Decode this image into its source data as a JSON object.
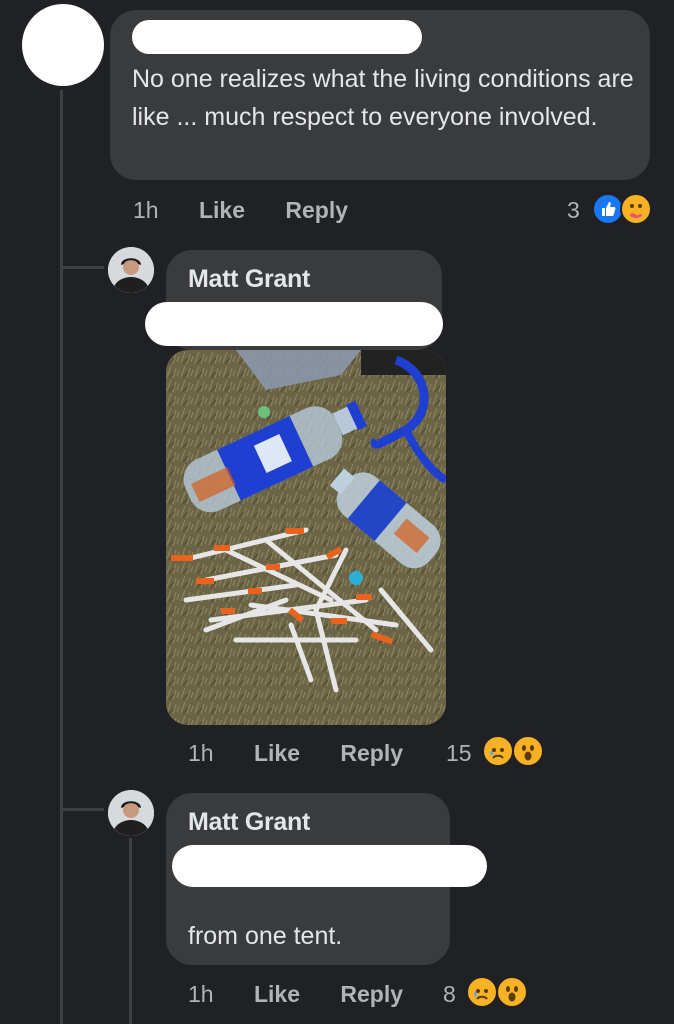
{
  "comments": [
    {
      "author": "",
      "text": "No one realizes what the living conditions are like ... much respect to everyone involved.",
      "time": "1h",
      "like_label": "Like",
      "reply_label": "Reply",
      "reaction_count": "3",
      "reactions": [
        "like-icon",
        "care-icon"
      ]
    },
    {
      "author": "Matt Grant",
      "text": "",
      "time": "1h",
      "like_label": "Like",
      "reply_label": "Reply",
      "reaction_count": "15",
      "reactions": [
        "sad-icon",
        "wow-icon"
      ],
      "attachment": "photo of plastic bottles and discarded syringes on grass"
    },
    {
      "author": "Matt Grant",
      "text": "from one tent.",
      "time": "1h",
      "like_label": "Like",
      "reply_label": "Reply",
      "reaction_count": "8",
      "reactions": [
        "sad-icon",
        "wow-icon"
      ]
    }
  ],
  "colors": {
    "background": "#202124",
    "bubble": "#3a3b3c",
    "text": "#e4e6eb",
    "meta": "#b0b3b8",
    "like_blue": "#1877f2"
  }
}
